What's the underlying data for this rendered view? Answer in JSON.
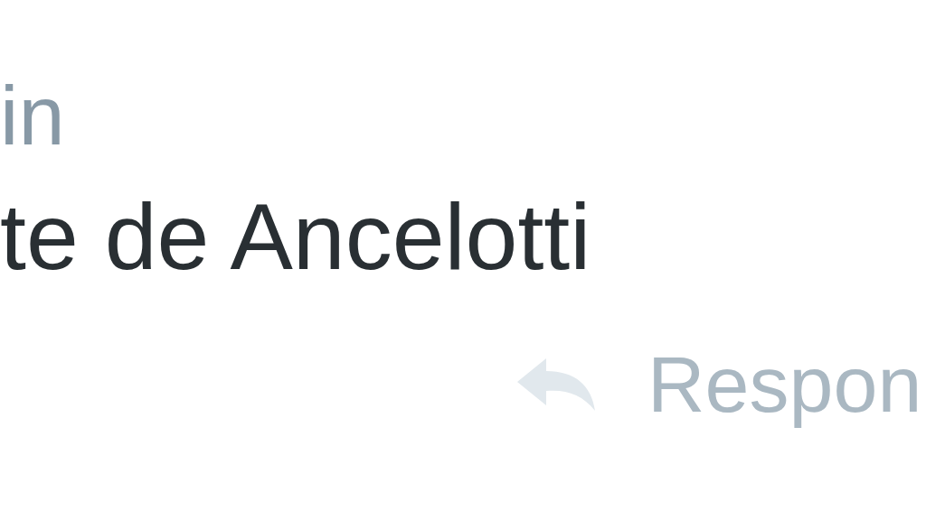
{
  "tweet": {
    "author_fragment": "in",
    "text_fragment": "te de Ancelotti"
  },
  "actions": [
    {
      "kind": "reply",
      "label": "Respon"
    }
  ]
}
